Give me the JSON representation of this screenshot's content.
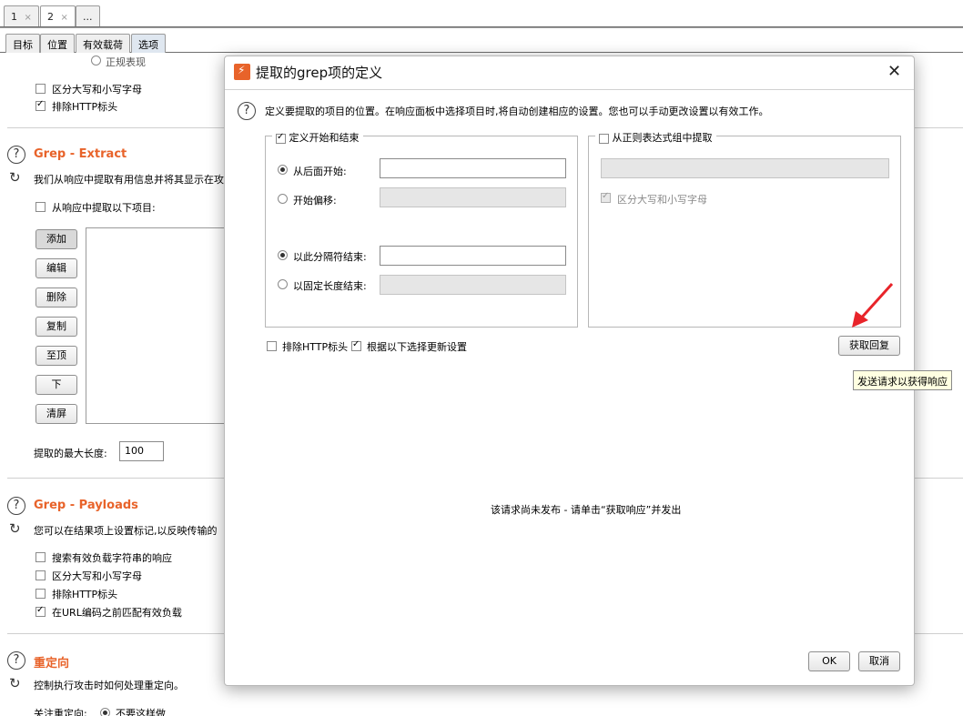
{
  "window_tabs": [
    {
      "label": "1",
      "close": "×"
    },
    {
      "label": "2",
      "close": "×"
    },
    {
      "label": "..."
    }
  ],
  "sub_tabs": [
    "目标",
    "位置",
    "有效载荷",
    "选项"
  ],
  "background": {
    "partial_top_label": "正规表现",
    "top_checks": [
      {
        "label": "区分大写和小写字母",
        "checked": false
      },
      {
        "label": "排除HTTP标头",
        "checked": true
      }
    ],
    "grep_extract": {
      "title": "Grep - Extract",
      "desc": "我们从响应中提取有用信息并将其显示在攻",
      "extract_check": "从响应中提取以下项目:",
      "buttons": [
        "添加",
        "编辑",
        "删除",
        "复制",
        "至顶",
        "下",
        "清屏"
      ],
      "max_len_label": "提取的最大长度:",
      "max_len_value": "100"
    },
    "grep_payloads": {
      "title": "Grep - Payloads",
      "desc": "您可以在结果项上设置标记,以反映传输的",
      "checks": [
        {
          "label": "搜索有效负载字符串的响应",
          "checked": false
        },
        {
          "label": "区分大写和小写字母",
          "checked": false
        },
        {
          "label": "排除HTTP标头",
          "checked": false
        },
        {
          "label": "在URL编码之前匹配有效负载",
          "checked": true
        }
      ]
    },
    "redirect": {
      "title": "重定向",
      "desc": "控制执行攻击时如何处理重定向。",
      "follow_label": "关注重定向:",
      "follow_value": "不要这样做"
    }
  },
  "dialog": {
    "title": "提取的grep项的定义",
    "close": "✕",
    "help_text": "定义要提取的项目的位置。在响应面板中选择项目时,将自动创建相应的设置。您也可以手动更改设置以有效工作。",
    "left_group": {
      "title": "定义开始和结束",
      "checked": true,
      "start_after_label": "从后面开始:",
      "start_after_value": "",
      "start_offset_label": "开始偏移:",
      "end_delim_label": "以此分隔符结束:",
      "end_delim_value": "",
      "end_fixed_label": "以固定长度结束:"
    },
    "right_group": {
      "title": "从正则表达式组中提取",
      "checked": false,
      "case_label": "区分大写和小写字母",
      "case_checked": true
    },
    "exclude_headers": {
      "label": "排除HTTP标头",
      "checked": false
    },
    "update_config": {
      "label": "根据以下选择更新设置",
      "checked": true
    },
    "fetch_button": "获取回复",
    "tooltip": "发送请求以获得响应",
    "response_placeholder": "该请求尚未发布 - 请单击“获取响应”并发出",
    "ok": "OK",
    "cancel": "取消"
  },
  "colors": {
    "accent": "#e8632a",
    "arrow": "#e8242a",
    "tooltip_bg": "#ffffe1"
  }
}
